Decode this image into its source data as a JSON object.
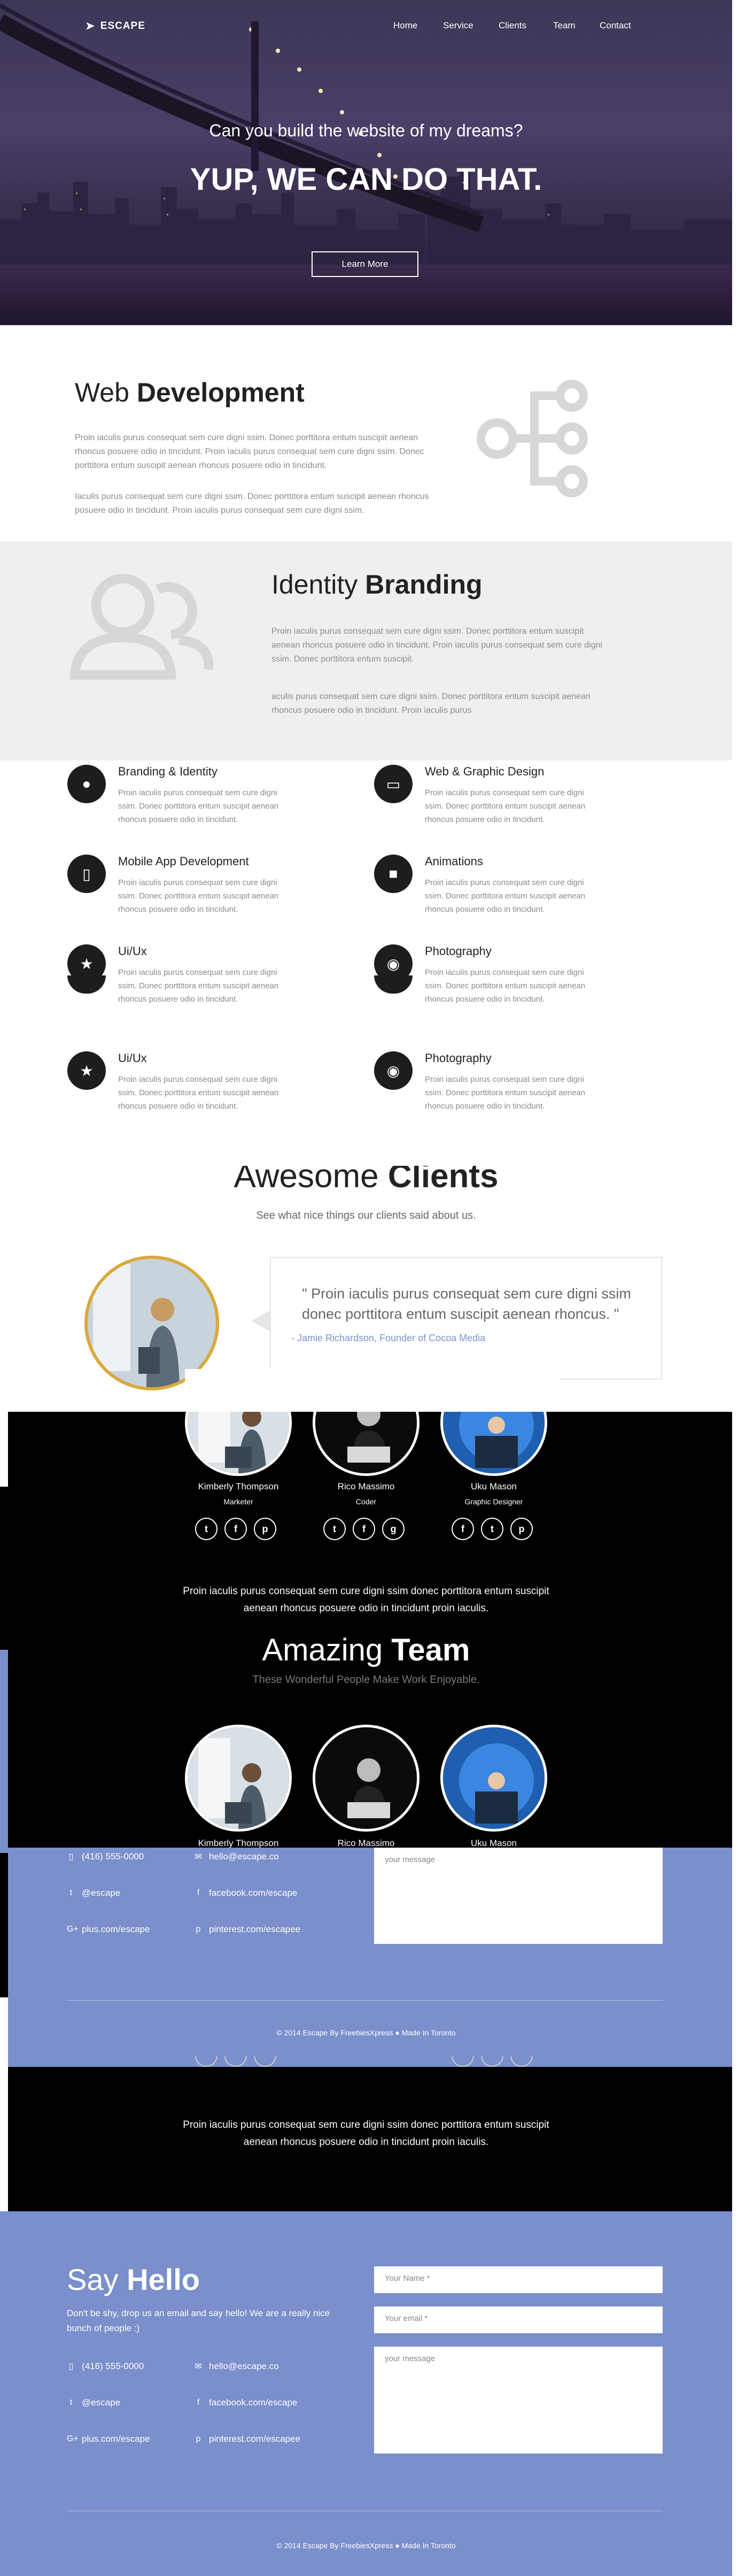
{
  "brand": {
    "name": "ESCAPE"
  },
  "nav": [
    "Home",
    "Service",
    "Clients",
    "Team",
    "Contact"
  ],
  "hero": {
    "subtitle": "Can you build the website of my dreams?",
    "title": "YUP, WE CAN DO THAT.",
    "button": "Learn More"
  },
  "webdev": {
    "title_light": "Web",
    "title_bold": "Development",
    "para1": "Proin iaculis purus consequat sem cure digni ssim. Donec porttitora entum suscipit aenean rhoncus posuere odio in tincidunt. Proin iaculis purus consequat sem cure digni ssim. Donec porttitora entum suscipit aenean rhoncus posuere odio in tincidunt.",
    "para2": "Iaculis purus consequat sem cure digni ssim. Donec porttitora entum suscipit aenean rhoncus posuere odio in tincidunt. Proin iaculis purus consequat sem cure digni ssim."
  },
  "branding": {
    "title_light": "Identity",
    "title_bold": "Branding",
    "para1": "Proin iaculis purus consequat sem cure digni ssim. Donec porttitora entum suscipit aenean rhoncus posuere odio in tincidunt. Proin iaculis purus consequat sem cure digni ssim. Donec porttitora entum suscipit.",
    "para2": "aculis purus consequat sem cure digni ssim. Donec porttitora entum suscipit aenean rhoncus posuere odio in tincidunt. Proin iaculis purus"
  },
  "services": [
    {
      "title": "Branding & Identity",
      "icon": "person-icon",
      "desc": "Proin iaculis purus consequat sem cure digni ssim. Donec porttitora entum suscipit aenean rhoncus posuere odio in tincidunt."
    },
    {
      "title": "Web & Graphic Design",
      "icon": "browser-icon",
      "desc": "Proin iaculis purus consequat sem cure digni ssim. Donec porttitora entum suscipit aenean rhoncus posuere odio in tincidunt."
    },
    {
      "title": "Mobile App Development",
      "icon": "mobile-icon",
      "desc": "Proin iaculis purus consequat sem cure digni ssim. Donec porttitora entum suscipit aenean rhoncus posuere odio in tincidunt."
    },
    {
      "title": "Animations",
      "icon": "video-icon",
      "desc": "Proin iaculis purus consequat sem cure digni ssim. Donec porttitora entum suscipit aenean rhoncus posuere odio in tincidunt."
    },
    {
      "title": "Ui/Ux",
      "icon": "star-icon",
      "desc": "Proin iaculis purus consequat sem cure digni ssim. Donec porttitora entum suscipit aenean rhoncus posuere odio in tincidunt."
    },
    {
      "title": "Photography",
      "icon": "camera-icon",
      "desc": "Proin iaculis purus consequat sem cure digni ssim. Donec porttitora entum suscipit aenean rhoncus posuere odio in tincidunt."
    },
    {
      "title": "Ui/Ux",
      "icon": "star-icon",
      "desc": "Proin iaculis purus consequat sem cure digni ssim. Donec porttitora entum suscipit aenean rhoncus posuere odio in tincidunt."
    },
    {
      "title": "Photography",
      "icon": "camera-icon",
      "desc": "Proin iaculis purus consequat sem cure digni ssim. Donec porttitora entum suscipit aenean rhoncus posuere odio in tincidunt."
    }
  ],
  "clients": {
    "title_light": "Awesome",
    "title_bold": "Clients",
    "subtitle": "See what nice things our clients said about us.",
    "quote": "\" Proin iaculis purus consequat sem cure digni ssim donec porttitora entum suscipit aenean rhoncus. \"",
    "author": "- Jamie Richardson, Founder of Cocoa Media"
  },
  "team": {
    "title_light": "Amazing",
    "title_bold": "Team",
    "subtitle": "These Wonderful People Make Work Enjoyable.",
    "para_line1": "Proin iaculis purus consequat sem cure digni ssim donec porttitora entum suscipit",
    "para_line2": "aenean rhoncus posuere odio in tincidunt proin iaculis.",
    "members": [
      {
        "name": "Kimberly Thompson",
        "role": "Marketer"
      },
      {
        "name": "Rico Massimo",
        "role": "Coder"
      },
      {
        "name": "Uku Mason",
        "role": "Graphic Designer"
      }
    ]
  },
  "contact": {
    "title_light": "Say",
    "title_bold": "Hello",
    "intro": "Don't be shy, drop us an email and say hello! We are a really nice bunch of people :)",
    "phone": "(416) 555-0000",
    "email": "hello@escape.co",
    "twitter": "@escape",
    "facebook": "facebook.com/escape",
    "gplus": "plus.com/escape",
    "pinterest": "pinterest.com/escapee",
    "name_placeholder": "Your Name *",
    "email_placeholder": "Your email *",
    "message_placeholder": "your message",
    "copyright": "© 2014 Escape By FreebiesXpress ● Made In Toronto"
  },
  "colors": {
    "footer_blue": "#7a8fcb",
    "gold_border": "#d9a93a",
    "link_blue": "#7c93c9"
  }
}
